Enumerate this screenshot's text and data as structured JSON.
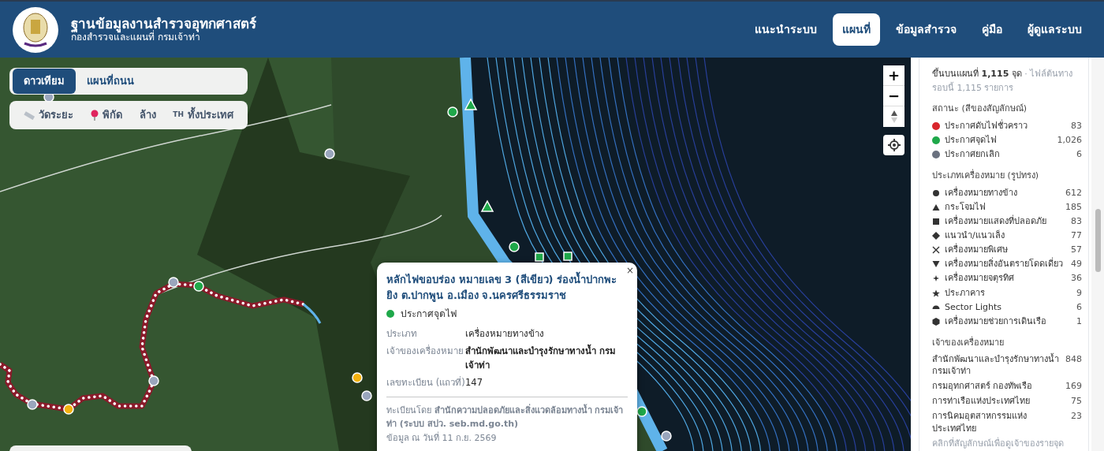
{
  "header": {
    "title": "ฐานข้อมูลงานสำรวจอุทกศาสตร์",
    "subtitle": "กองสำรวจและแผนที่ กรมเจ้าท่า",
    "nav": [
      {
        "label": "แนะนำระบบ",
        "selected": false
      },
      {
        "label": "แผนที่",
        "selected": true
      },
      {
        "label": "ข้อมูลสำรวจ",
        "selected": false
      },
      {
        "label": "คู่มือ",
        "selected": false
      },
      {
        "label": "ผู้ดูแลระบบ",
        "selected": false
      }
    ]
  },
  "map": {
    "base_layers": [
      {
        "label": "ดาวเทียม",
        "selected": true
      },
      {
        "label": "แผนที่ถนน",
        "selected": false
      }
    ],
    "tools": [
      {
        "kind": "ruler",
        "label": "วัดระยะ"
      },
      {
        "kind": "pin",
        "label": "พิกัด"
      },
      {
        "kind": "plain",
        "label": "ล้าง"
      },
      {
        "kind": "prefix",
        "prefix": "TH",
        "label": "ทั้งประเทศ"
      }
    ],
    "zoom_in": "+",
    "zoom_out": "−",
    "popup": {
      "title": "หลักไฟขอบร่อง หมายเลข 3 (สีเขียว) ร่องน้ำปากพะยิง ต.ปากพูน อ.เมือง จ.นครศรีธรรมราช",
      "close": "×",
      "status": {
        "label": "ประกาศจุดไฟ",
        "color": "#1fa84a"
      },
      "fields": [
        {
          "label": "ประเภท",
          "value": "เครื่องหมายทางข้าง",
          "emphasis": false
        },
        {
          "label": "เจ้าของเครื่องหมาย",
          "value": "สำนักพัฒนาและบำรุงรักษาทางน้ำ กรมเจ้าท่า",
          "emphasis": true
        },
        {
          "label": "เลขทะเบียน (แถวที่)",
          "value": "147",
          "emphasis": false
        }
      ],
      "source": "ทะเบียนโดย **สำนักความปลอดภัยและสิ่งแวดล้อมทางน้ำ กรมเจ้าท่า (ระบบ สปว. seb.md.go.th)**",
      "date": "ข้อมูล ณ วันที่ 11 ก.ย. 2569"
    }
  },
  "sidebar": {
    "summary": "ขึ้นบนแผนที่ **1,115** จุด",
    "summary_note": "· ไฟล์ต้นทางรอบนี้ 1,115 รายการ",
    "status_heading": "สถานะ (สีของสัญลักษณ์)",
    "status_items": [
      {
        "label": "ประกาศดับไฟชั่วคราว",
        "count": "83",
        "color": "#d9262c"
      },
      {
        "label": "ประกาศจุดไฟ",
        "count": "1,026",
        "color": "#1fa84a"
      },
      {
        "label": "ประกาศยกเลิก",
        "count": "6",
        "color": "#6b7280"
      }
    ],
    "shape_heading": "ประเภทเครื่องหมาย (รูปทรง)",
    "shape_items": [
      {
        "kind": "circle",
        "label": "เครื่องหมายทางข้าง",
        "count": "612"
      },
      {
        "kind": "triangle",
        "label": "กระโจมไฟ",
        "count": "185"
      },
      {
        "kind": "square",
        "label": "เครื่องหมายแสดงที่ปลอดภัย",
        "count": "83"
      },
      {
        "kind": "diamond",
        "label": "แนวนำ/แนวเล็ง",
        "count": "77"
      },
      {
        "kind": "cross",
        "label": "เครื่องหมายพิเศษ",
        "count": "57"
      },
      {
        "kind": "down-triangle",
        "label": "เครื่องหมายสิ่งอันตรายโดดเดี่ยว",
        "count": "49"
      },
      {
        "kind": "sparkle",
        "label": "เครื่องหมายจตุรทิศ",
        "count": "36"
      },
      {
        "kind": "star",
        "label": "ประภาคาร",
        "count": "9"
      },
      {
        "kind": "sector",
        "label": "Sector Lights",
        "count": "6"
      },
      {
        "kind": "hexagon",
        "label": "เครื่องหมายช่วยการเดินเรือ",
        "count": "1"
      }
    ],
    "owner_heading": "เจ้าของเครื่องหมาย",
    "owner_items": [
      {
        "label": "สำนักพัฒนาและบำรุงรักษาทางน้ำ กรมเจ้าท่า",
        "count": "848"
      },
      {
        "label": "กรมอุทกศาสตร์ กองทัพเรือ",
        "count": "169"
      },
      {
        "label": "การท่าเรือแห่งประเทศไทย",
        "count": "75"
      },
      {
        "label": "การนิคมอุตสาหกรรมแห่งประเทศไทย",
        "count": "23"
      }
    ],
    "owner_hint": "คลิกที่สัญลักษณ์เพื่อดูเจ้าของรายจุด"
  }
}
